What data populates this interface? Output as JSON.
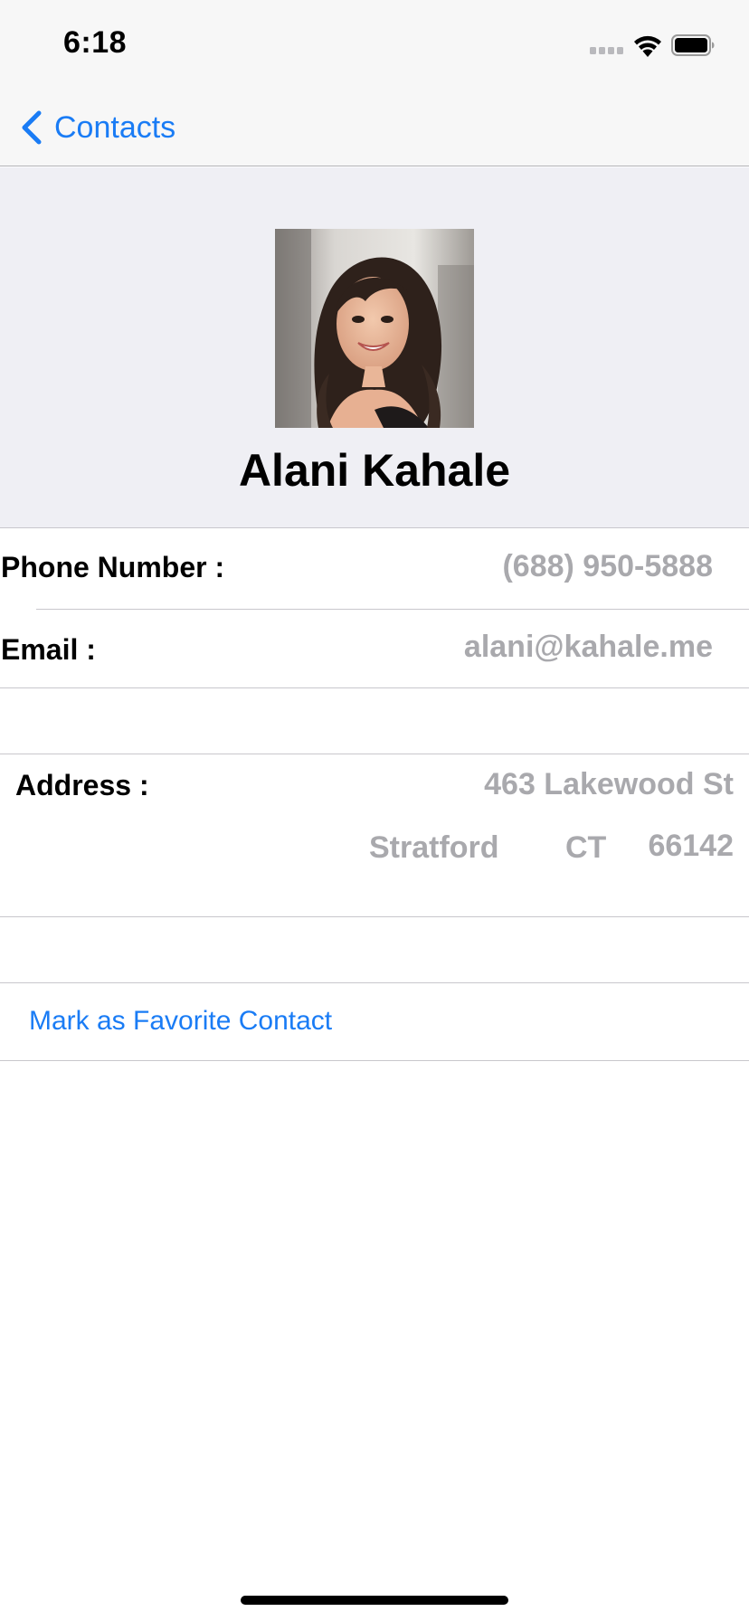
{
  "status_bar": {
    "time": "6:18"
  },
  "nav": {
    "back_label": "Contacts",
    "back_icon": "chevron-left-icon",
    "accent_color": "#1a7cf5"
  },
  "contact": {
    "name": "Alani Kahale",
    "phone_label": "Phone Number :",
    "phone_value": "(688) 950-5888",
    "email_label": "Email :",
    "email_value": "alani@kahale.me",
    "address_label": "Address :",
    "address_street": "463 Lakewood St",
    "address_city": "Stratford",
    "address_state": "CT",
    "address_zip": "66142"
  },
  "actions": {
    "favorite_label": "Mark as Favorite Contact"
  },
  "colors": {
    "value_text": "#a9a9ad",
    "header_background": "#efeff4",
    "link": "#1a7cf5"
  }
}
